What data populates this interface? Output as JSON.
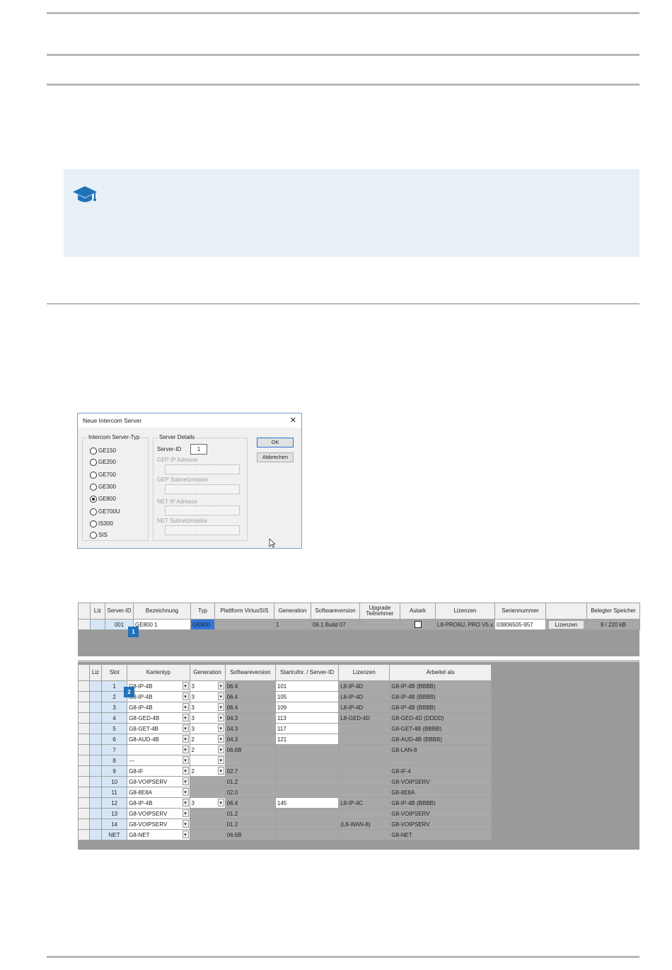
{
  "dialog": {
    "title": "Neue Intercom Server",
    "close_glyph": "✕",
    "type_group_label": "Intercom Server-Typ",
    "types": [
      "GE150",
      "GE200",
      "GE700",
      "GE300",
      "GE800",
      "GE700U",
      "IS300",
      "SIS"
    ],
    "selected_type": "GE800",
    "details_group_label": "Server Details",
    "server_id_label": "Server-ID",
    "server_id_value": "1",
    "gep_ip_label": "GEP IP Adresse",
    "gep_subnet_label": "GEP Subnetzmaske",
    "net_ip_label": "NET IP Adresse",
    "net_subnet_label": "NET Subnetzmaske",
    "ip_placeholder": "...",
    "ok_label": "OK",
    "cancel_label": "Abbrechen"
  },
  "server_table": {
    "headers": [
      "Liz",
      "Server-ID",
      "Bezeichnung",
      "Typ",
      "Plattform VirtuoSIS",
      "Generation",
      "Softwareversion",
      "Upgrade Teilnehmer",
      "Autark",
      "Lizenzen",
      "Seriennummer",
      "",
      "Belegter Speicher"
    ],
    "row": {
      "server_id": "001",
      "name": "GE800 1",
      "type": "GE800",
      "generation": "1",
      "software": "06.1 Build 07",
      "licenses": "L8-PRO6U, PRO V5.x",
      "serial": "03806505-957",
      "licenses_button": "Lizenzen",
      "memory": "9 / 220 kB"
    },
    "marker": "1"
  },
  "card_table": {
    "headers": [
      "Liz",
      "Slot",
      "Kartentyp",
      "Generation",
      "Softwareversion",
      "Startrufnr. / Server-ID",
      "Lizenzen",
      "Arbeitet als"
    ],
    "marker": "2",
    "rows": [
      {
        "slot": "1",
        "type": "G8-IP-4B",
        "gen": "3",
        "sw": "06.4",
        "start": "101",
        "lic": "L8-IP-4D",
        "works": "G8-IP-4B (BBBB)"
      },
      {
        "slot": "2",
        "type": "G8-IP-4B",
        "gen": "3",
        "sw": "06.4",
        "start": "105",
        "lic": "L8-IP-4D",
        "works": "G8-IP-4B (BBBB)"
      },
      {
        "slot": "3",
        "type": "G8-IP-4B",
        "gen": "3",
        "sw": "06.4",
        "start": "109",
        "lic": "L8-IP-4D",
        "works": "G8-IP-4B (BBBB)"
      },
      {
        "slot": "4",
        "type": "G8-GED-4B",
        "gen": "3",
        "sw": "04.3",
        "start": "113",
        "lic": "L8-GED-4D",
        "works": "G8-GED-4D (DDDD)"
      },
      {
        "slot": "5",
        "type": "G8-GET-4B",
        "gen": "3",
        "sw": "04.3",
        "start": "117",
        "lic": "",
        "works": "G8-GET-4B (BBBB)"
      },
      {
        "slot": "6",
        "type": "G8-AUD-4B",
        "gen": "2",
        "sw": "04.3",
        "start": "121",
        "lic": "",
        "works": "G8-AUD-4B (BBBB)"
      },
      {
        "slot": "7",
        "type": "",
        "gen": "2",
        "sw": "06.6B",
        "start": "",
        "lic": "",
        "works": "G8-LAN-8"
      },
      {
        "slot": "8",
        "type": "---",
        "gen": "",
        "sw": "",
        "start": "",
        "lic": "",
        "works": ""
      },
      {
        "slot": "9",
        "type": "G8-IF",
        "gen": "2",
        "sw": "02.7",
        "start": "",
        "lic": "",
        "works": "G8-IF-4"
      },
      {
        "slot": "10",
        "type": "G8-VOIPSERV",
        "gen": "",
        "sw": "01.2",
        "start": "",
        "lic": "",
        "works": "G8-VOIPSERV"
      },
      {
        "slot": "11",
        "type": "G8-8E8A",
        "gen": "",
        "sw": "02.0",
        "start": "",
        "lic": "",
        "works": "G8-8E8A"
      },
      {
        "slot": "12",
        "type": "G8-IP-4B",
        "gen": "3",
        "sw": "06.4",
        "start": "145",
        "lic": "L8-IP-4C",
        "works": "G8-IP-4B (BBBB)"
      },
      {
        "slot": "13",
        "type": "G8-VOIPSERV",
        "gen": "",
        "sw": "01.2",
        "start": "",
        "lic": "",
        "works": "G8-VOIPSERV"
      },
      {
        "slot": "14",
        "type": "G8-VOIPSERV",
        "gen": "",
        "sw": "01.2",
        "start": "",
        "lic": "(L8-WAN-8)",
        "works": "G8-VOIPSERV"
      },
      {
        "slot": "NET",
        "type": "G8-NET",
        "gen": "",
        "sw": "06.6B",
        "start": "",
        "lic": "",
        "works": "G8-NET"
      }
    ]
  }
}
